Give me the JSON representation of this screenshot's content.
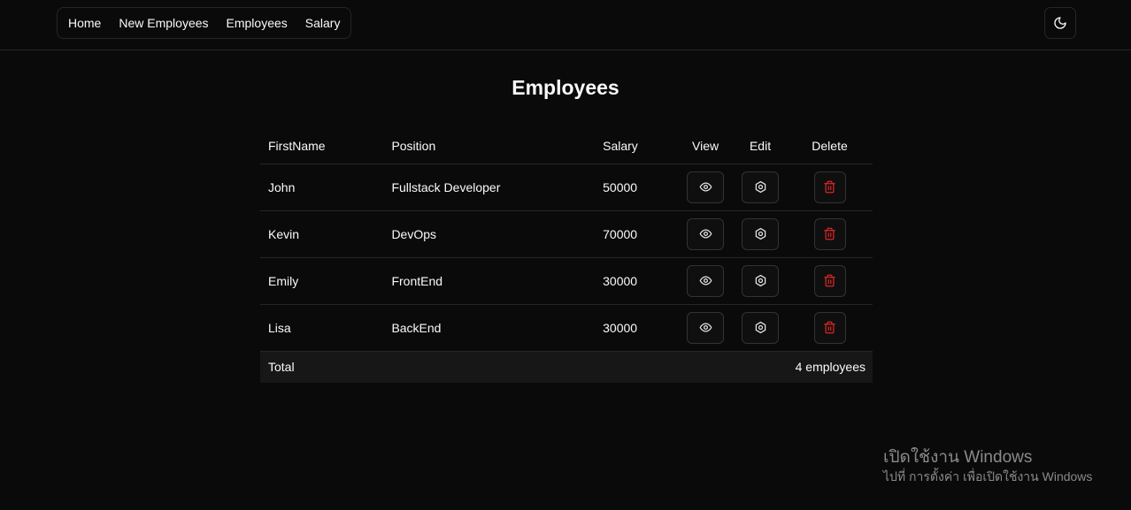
{
  "nav": {
    "items": [
      {
        "label": "Home"
      },
      {
        "label": "New Employees"
      },
      {
        "label": "Employees"
      },
      {
        "label": "Salary"
      }
    ]
  },
  "theme_toggle": {
    "icon": "moon-icon"
  },
  "page": {
    "title": "Employees"
  },
  "table": {
    "headers": {
      "first_name": "FirstName",
      "position": "Position",
      "salary": "Salary",
      "view": "View",
      "edit": "Edit",
      "delete": "Delete"
    },
    "rows": [
      {
        "first_name": "John",
        "position": "Fullstack Developer",
        "salary": "50000"
      },
      {
        "first_name": "Kevin",
        "position": "DevOps",
        "salary": "70000"
      },
      {
        "first_name": "Emily",
        "position": "FrontEnd",
        "salary": "30000"
      },
      {
        "first_name": "Lisa",
        "position": "BackEnd",
        "salary": "30000"
      }
    ],
    "footer": {
      "label": "Total",
      "count": "4 employees"
    },
    "icons": {
      "view": "eye-icon",
      "edit": "settings-icon",
      "delete": "trash-icon"
    }
  },
  "colors": {
    "background": "#0a0a0a",
    "border": "#262626",
    "delete_accent": "#dc2626"
  },
  "watermark": {
    "title": "เปิดใช้งาน Windows",
    "subtitle": "ไปที่ การตั้งค่า เพื่อเปิดใช้งาน Windows"
  }
}
